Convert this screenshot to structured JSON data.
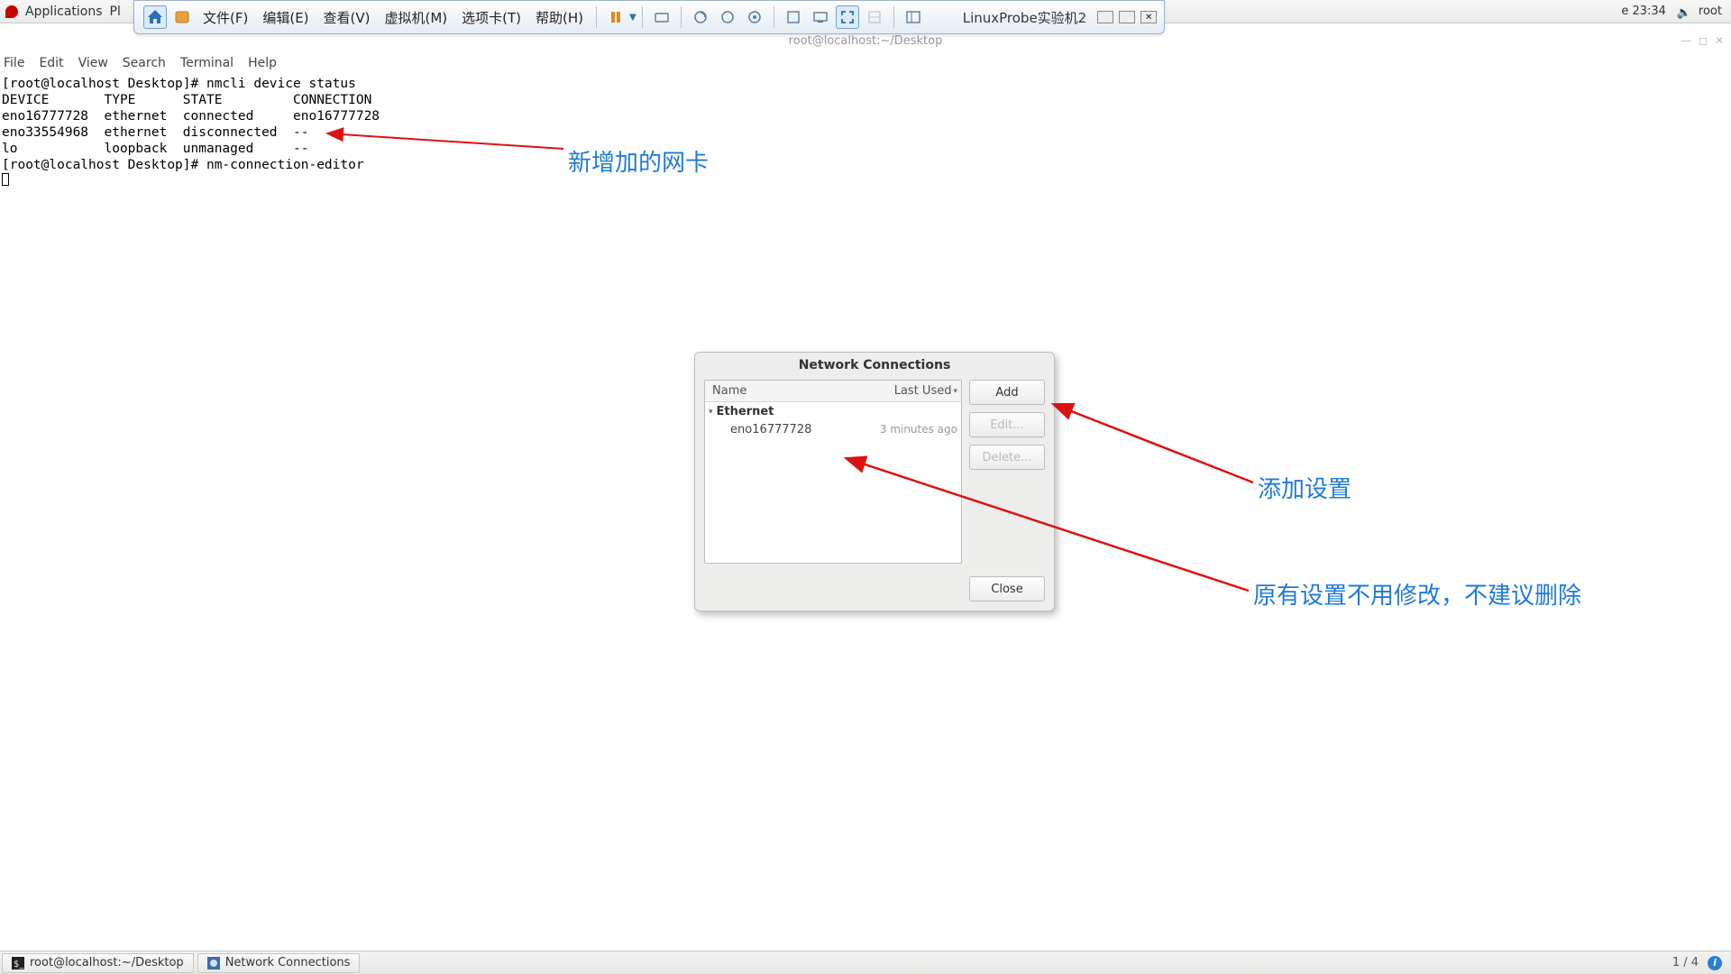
{
  "gnome": {
    "applications": "Applications",
    "places_short": "Pl",
    "time": "e 23:34",
    "user": "root"
  },
  "vmware": {
    "menu": {
      "file": "文件(F)",
      "edit": "编辑(E)",
      "view": "查看(V)",
      "vm": "虚拟机(M)",
      "tabs": "选项卡(T)",
      "help": "帮助(H)"
    },
    "tab_title": "LinuxProbe实验机2"
  },
  "terminal": {
    "window_title": "root@localhost:~/Desktop",
    "menu": {
      "file": "File",
      "edit": "Edit",
      "view": "View",
      "search": "Search",
      "terminal": "Terminal",
      "help": "Help"
    },
    "content": "[root@localhost Desktop]# nmcli device status\nDEVICE       TYPE      STATE         CONNECTION\neno16777728  ethernet  connected     eno16777728\neno33554968  ethernet  disconnected  --\nlo           loopback  unmanaged     --\n[root@localhost Desktop]# nm-connection-editor"
  },
  "dialog": {
    "title": "Network Connections",
    "col_name": "Name",
    "col_last": "Last Used",
    "group": "Ethernet",
    "item_name": "eno16777728",
    "item_time": "3 minutes ago",
    "btn_add": "Add",
    "btn_edit": "Edit...",
    "btn_delete": "Delete...",
    "btn_close": "Close"
  },
  "annotations": {
    "new_nic": "新增加的网卡",
    "add_setting": "添加设置",
    "keep_existing": "原有设置不用修改，不建议删除"
  },
  "taskbar": {
    "task1": "root@localhost:~/Desktop",
    "task2": "Network Connections",
    "workspace": "1 / 4"
  }
}
